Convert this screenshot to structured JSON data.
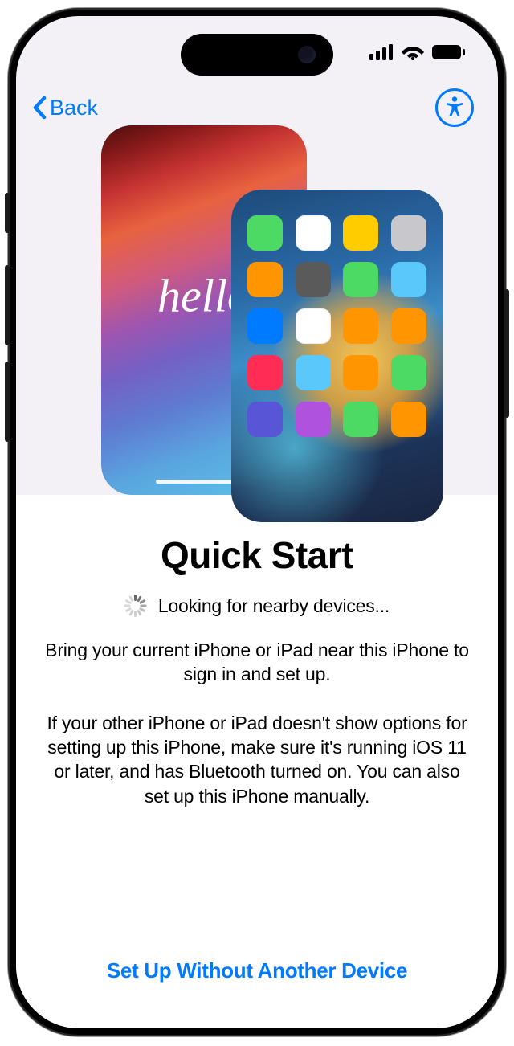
{
  "nav": {
    "back_label": "Back"
  },
  "hero": {
    "hello_text": "hello",
    "app_icon_colors": [
      "#4cd964",
      "#ffffff",
      "#ffcc00",
      "#c7c7cc",
      "#ff9500",
      "#5a5a5a",
      "#4cd964",
      "#5ac8fa",
      "#007aff",
      "#ffffff",
      "#ff9500",
      "#ff9500",
      "#ff2d55",
      "#5ac8fa",
      "#ff9500",
      "#4cd964",
      "#5856d6",
      "#af52de",
      "#4cd964",
      "#ff9500"
    ]
  },
  "content": {
    "title": "Quick Start",
    "status": "Looking for nearby devices...",
    "body1": "Bring your current iPhone or iPad near this iPhone to sign in and set up.",
    "body2": "If your other iPhone or iPad doesn't show options for setting up this iPhone, make sure it's running iOS 11 or later, and has Bluetooth turned on. You can also set up this iPhone manually."
  },
  "footer": {
    "setup_manual_label": "Set Up Without Another Device"
  }
}
